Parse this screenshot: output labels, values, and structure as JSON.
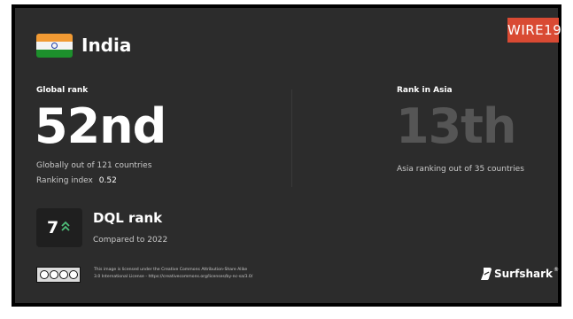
{
  "header": {
    "country": "India",
    "brand_badge": "WIRE19"
  },
  "global": {
    "label": "Global rank",
    "rank": "52nd",
    "subtitle": "Globally out of 121 countries",
    "index_label": "Ranking index",
    "index_value": "0.52"
  },
  "asia": {
    "label": "Rank in Asia",
    "rank": "13th",
    "subtitle": "Asia ranking out of 35 countries"
  },
  "dql": {
    "change": "7",
    "title": "DQL rank",
    "subtitle": "Compared to 2022",
    "arrow_icon": "double-chevron-up-icon",
    "arrow_color": "#4fbf7a"
  },
  "footer": {
    "license_line1": "This image is licensed under the Creative Commons Attribution-Share Alike",
    "license_line2": "3.0 International License - https://creativecommons.org/licenses/by-nc-sa/3.0/",
    "license_badge": "cc-by-nc-sa-icon",
    "brand": "Surfshark",
    "brand_mark": "®"
  },
  "colors": {
    "card_background": "#2c2c2c",
    "badge": "#d94a33",
    "rank_asia": "#555555"
  }
}
